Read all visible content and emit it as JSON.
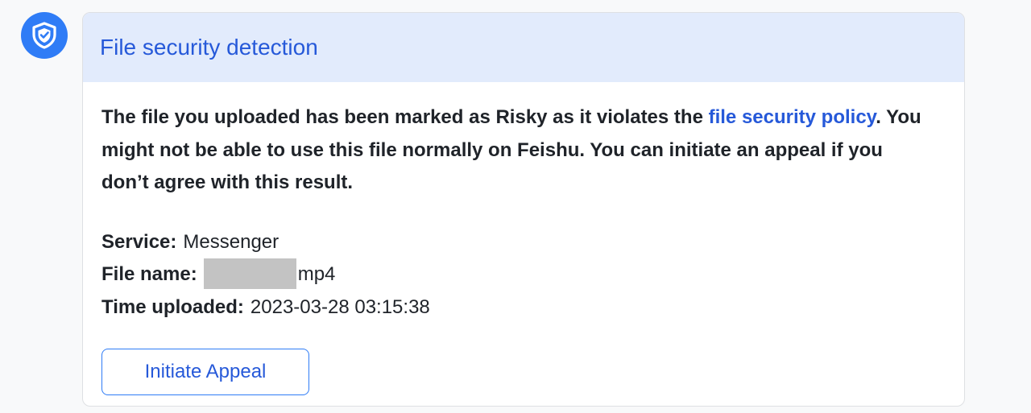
{
  "bot": {
    "avatar_icon": "shield-check-icon",
    "avatar_color": "#2f7cf6"
  },
  "card": {
    "title": "File security detection",
    "header_color": "#e2ebfc",
    "accent_color": "#2659d9",
    "message": {
      "part1": "The file you uploaded has been marked as Risky as it violates the ",
      "link_text": "file security policy",
      "part2": ". You might not be able to use this file normally on Feishu. You can initiate an appeal if you don’t agree with this result."
    },
    "details": {
      "service_label": "Service:",
      "service_value": "Messenger",
      "file_name_label": "File name:",
      "file_name_suffix": "mp4",
      "time_label": "Time uploaded:",
      "time_value": "2023-03-28 03:15:38"
    },
    "appeal_button_label": "Initiate Appeal"
  }
}
